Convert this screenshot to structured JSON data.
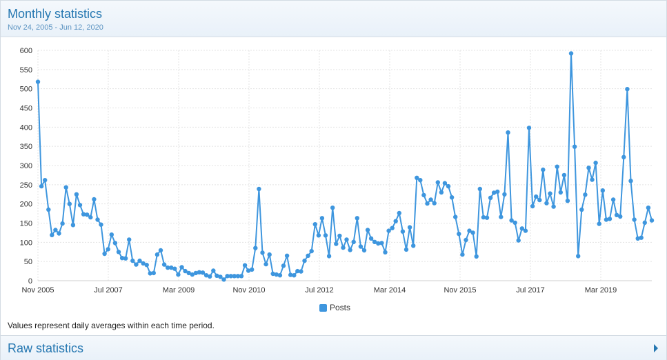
{
  "header": {
    "title": "Monthly statistics",
    "range": "Nov 24, 2005 - Jun 12, 2020"
  },
  "footer": {
    "note": "Values represent daily averages within each time period.",
    "raw_title": "Raw statistics",
    "expand_icon": "triangle-right-icon"
  },
  "chart_data": {
    "type": "line",
    "x_labels": [
      "Nov 2005",
      "Jul 2007",
      "Mar 2009",
      "Nov 2010",
      "Jul 2012",
      "Mar 2014",
      "Nov 2015",
      "Jul 2017",
      "Mar 2019"
    ],
    "y_ticks": [
      0,
      50,
      100,
      150,
      200,
      250,
      300,
      350,
      400,
      450,
      500,
      550,
      600
    ],
    "ylim": [
      0,
      600
    ],
    "grid": true,
    "legend": "bottom-center",
    "color": "#3e96de",
    "series": [
      {
        "name": "Posts",
        "values": [
          518,
          246,
          262,
          185,
          119,
          132,
          123,
          149,
          243,
          200,
          145,
          225,
          197,
          173,
          172,
          165,
          212,
          159,
          146,
          70,
          82,
          120,
          98,
          75,
          59,
          58,
          107,
          52,
          42,
          52,
          45,
          41,
          19,
          20,
          68,
          79,
          42,
          34,
          34,
          31,
          16,
          35,
          25,
          20,
          16,
          20,
          22,
          21,
          14,
          11,
          26,
          13,
          10,
          3,
          12,
          12,
          12,
          12,
          12,
          40,
          26,
          29,
          85,
          239,
          73,
          43,
          68,
          18,
          16,
          14,
          39,
          65,
          15,
          14,
          25,
          24,
          52,
          65,
          77,
          147,
          118,
          163,
          118,
          64,
          190,
          96,
          117,
          86,
          107,
          80,
          101,
          163,
          89,
          79,
          132,
          110,
          101,
          97,
          98,
          74,
          130,
          137,
          155,
          176,
          128,
          81,
          139,
          91,
          268,
          262,
          223,
          201,
          211,
          202,
          256,
          230,
          254,
          246,
          217,
          166,
          122,
          68,
          106,
          130,
          125,
          63,
          239,
          165,
          164,
          216,
          229,
          232,
          166,
          225,
          386,
          157,
          151,
          105,
          136,
          130,
          398,
          194,
          219,
          210,
          289,
          202,
          227,
          193,
          297,
          230,
          275,
          208,
          592,
          349,
          64,
          185,
          224,
          294,
          263,
          307,
          148,
          235,
          159,
          161,
          211,
          171,
          167,
          322,
          499,
          260,
          159,
          110,
          112,
          151,
          190,
          157
        ]
      }
    ]
  }
}
